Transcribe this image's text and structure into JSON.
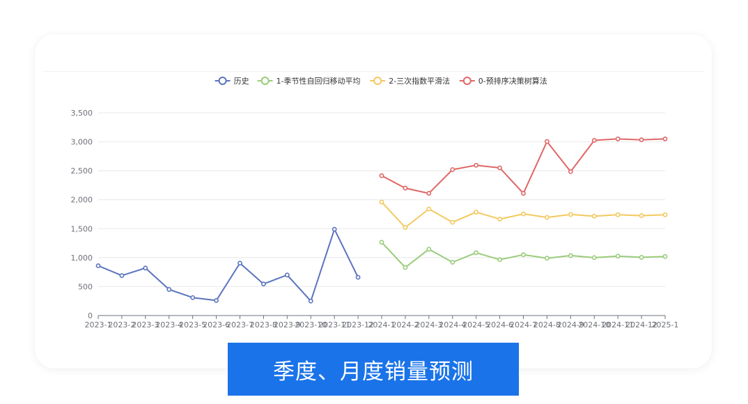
{
  "banner": {
    "title": "季度、月度销量预测"
  },
  "chart_data": {
    "type": "line",
    "categories": [
      "2023-1",
      "2023-2",
      "2023-3",
      "2023-4",
      "2023-5",
      "2023-6",
      "2023-7",
      "2023-8",
      "2023-9",
      "2023-10",
      "2023-11",
      "2023-12",
      "2024-1",
      "2024-2",
      "2024-3",
      "2024-4",
      "2024-5",
      "2024-6",
      "2024-7",
      "2024-8",
      "2024-9",
      "2024-10",
      "2024-11",
      "2024-12",
      "2025-1"
    ],
    "ylim": [
      0,
      3500
    ],
    "yticks": [
      0,
      500,
      1000,
      1500,
      2000,
      2500,
      3000,
      3500
    ],
    "ytick_labels": [
      "0",
      "500",
      "1,000",
      "1,500",
      "2,000",
      "2,500",
      "3,000",
      "3,500"
    ],
    "legend_position": "top-center",
    "grid": true,
    "series": [
      {
        "name": "历史",
        "color": "#5b73be",
        "values": [
          860,
          690,
          820,
          450,
          310,
          260,
          905,
          545,
          700,
          250,
          1490,
          660,
          null,
          null,
          null,
          null,
          null,
          null,
          null,
          null,
          null,
          null,
          null,
          null,
          null
        ]
      },
      {
        "name": "1-季节性自回归移动平均",
        "color": "#99cc7a",
        "values": [
          null,
          null,
          null,
          null,
          null,
          null,
          null,
          null,
          null,
          null,
          null,
          null,
          1265,
          830,
          1145,
          920,
          1085,
          965,
          1050,
          990,
          1035,
          1000,
          1025,
          1005,
          1020
        ]
      },
      {
        "name": "2-三次指数平滑法",
        "color": "#f3c95e",
        "values": [
          null,
          null,
          null,
          null,
          null,
          null,
          null,
          null,
          null,
          null,
          null,
          null,
          1960,
          1520,
          1840,
          1610,
          1785,
          1665,
          1755,
          1695,
          1745,
          1715,
          1740,
          1725,
          1740
        ]
      },
      {
        "name": "0-预排序决策树算法",
        "color": "#e06666",
        "values": [
          null,
          null,
          null,
          null,
          null,
          null,
          null,
          null,
          null,
          null,
          null,
          null,
          2415,
          2200,
          2110,
          2520,
          2595,
          2550,
          2110,
          3005,
          2485,
          3025,
          3050,
          3035,
          3050
        ]
      }
    ]
  }
}
